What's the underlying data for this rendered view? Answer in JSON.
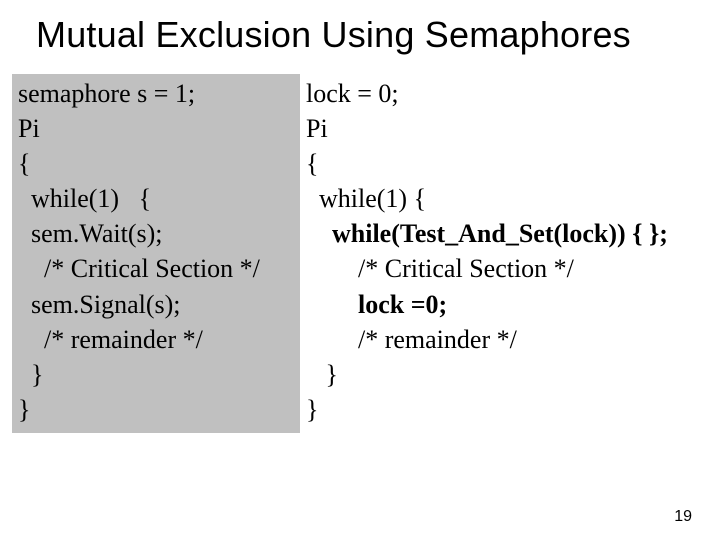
{
  "title": "Mutual Exclusion Using Semaphores",
  "page_number": "19",
  "left": {
    "l1": "semaphore s = 1;",
    "l2": "Pi",
    "l3": "{",
    "l4": "  while(1)   {",
    "l5": "  sem.Wait(s);",
    "l6": "    /* Critical Section */",
    "l7": "  sem.Signal(s);",
    "l8": "    /* remainder */",
    "l9": "  }",
    "l10": "}"
  },
  "right": {
    "l1": "lock = 0;",
    "l2": "Pi",
    "l3": "{",
    "l4": "  while(1) {",
    "l5_pre": "    ",
    "l5_bold": "while(Test_And_Set(lock)) { };",
    "l6": "        /* Critical Section */",
    "l7_pre": "        ",
    "l7_bold": "lock =0;",
    "l8": "        /* remainder */",
    "l9": "   }",
    "l10": "}"
  }
}
